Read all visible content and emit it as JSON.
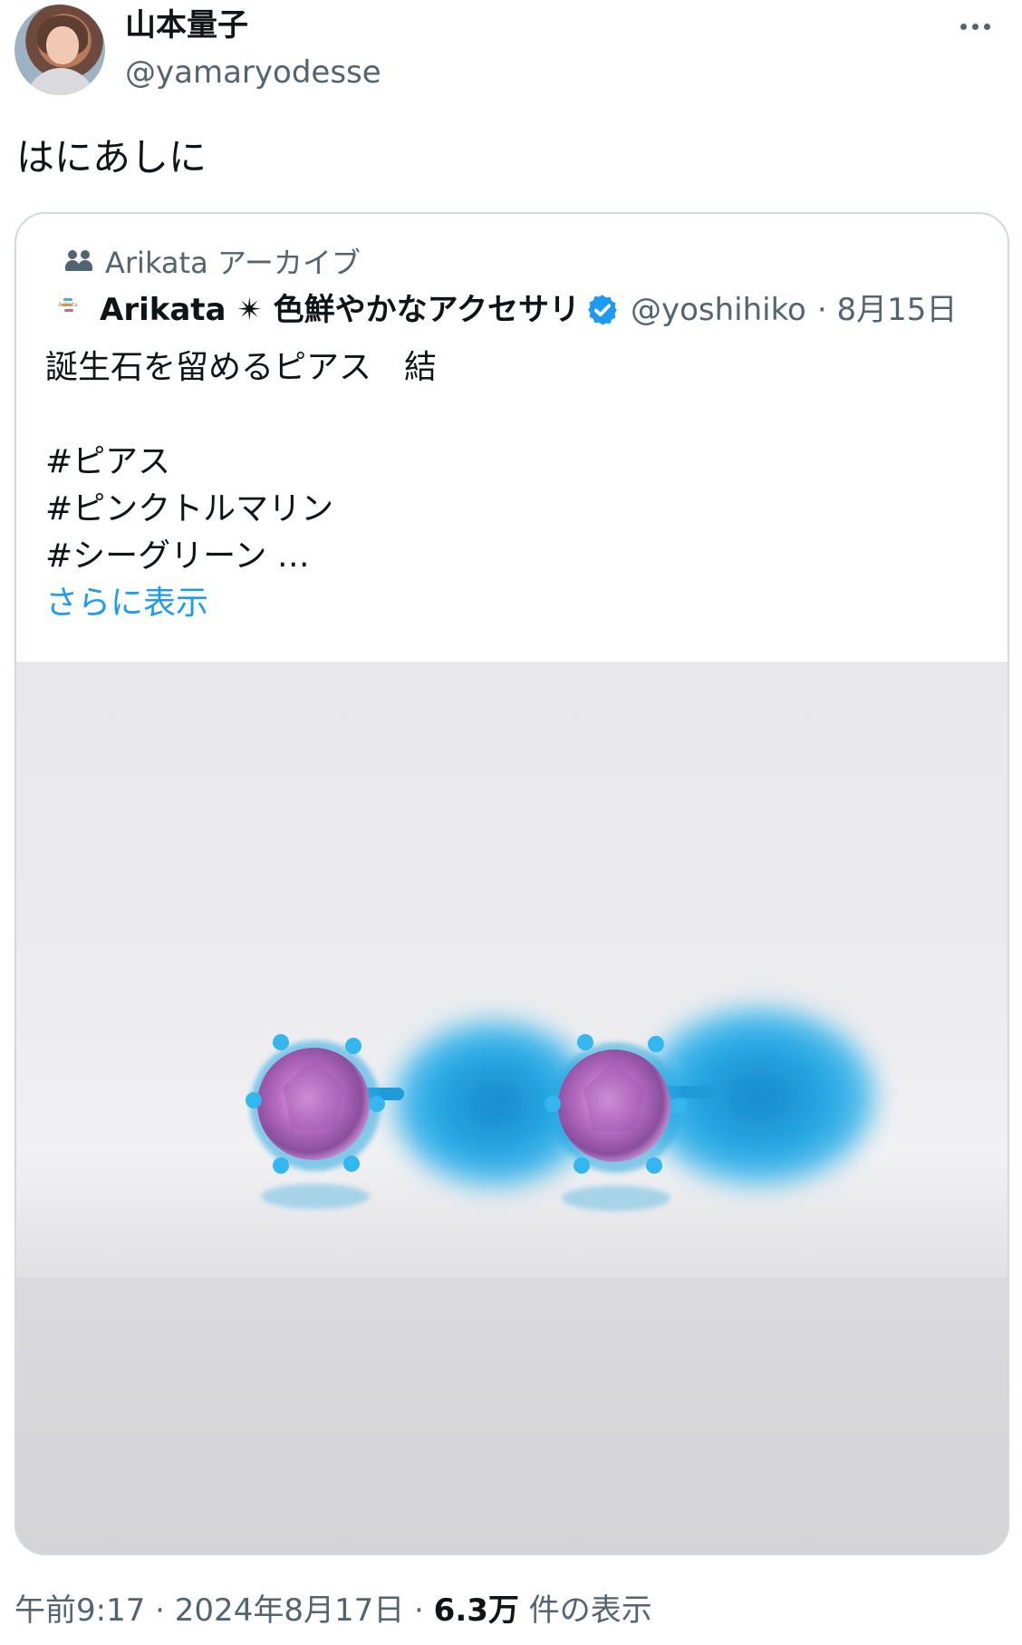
{
  "author": {
    "display_name": "山本量子",
    "handle": "@yamaryodesse"
  },
  "tweet": {
    "text": "はにあしに"
  },
  "quote": {
    "community": "Arikata アーカイブ",
    "brand_logo_text": "Arikata",
    "name": "Arikata ✴ 色鮮やかなアクセサリ",
    "handle": "@yoshihiko",
    "date": "· 8月15日",
    "body": "誕生石を留めるピアス　結\n\n#ピアス\n#ピンクトルマリン\n#シーグリーン …",
    "show_more": "さらに表示",
    "image_icon": "earrings-photo"
  },
  "footer": {
    "time": "午前9:17",
    "date": "2024年8月17日",
    "views_count": "6.3万",
    "views_label": "件の表示"
  },
  "colors": {
    "link": "#1d9bf0",
    "secondary_text": "#536471",
    "verified": "#1d9bf0",
    "gem": "#c77bc7",
    "post": "#1fa3e0"
  }
}
